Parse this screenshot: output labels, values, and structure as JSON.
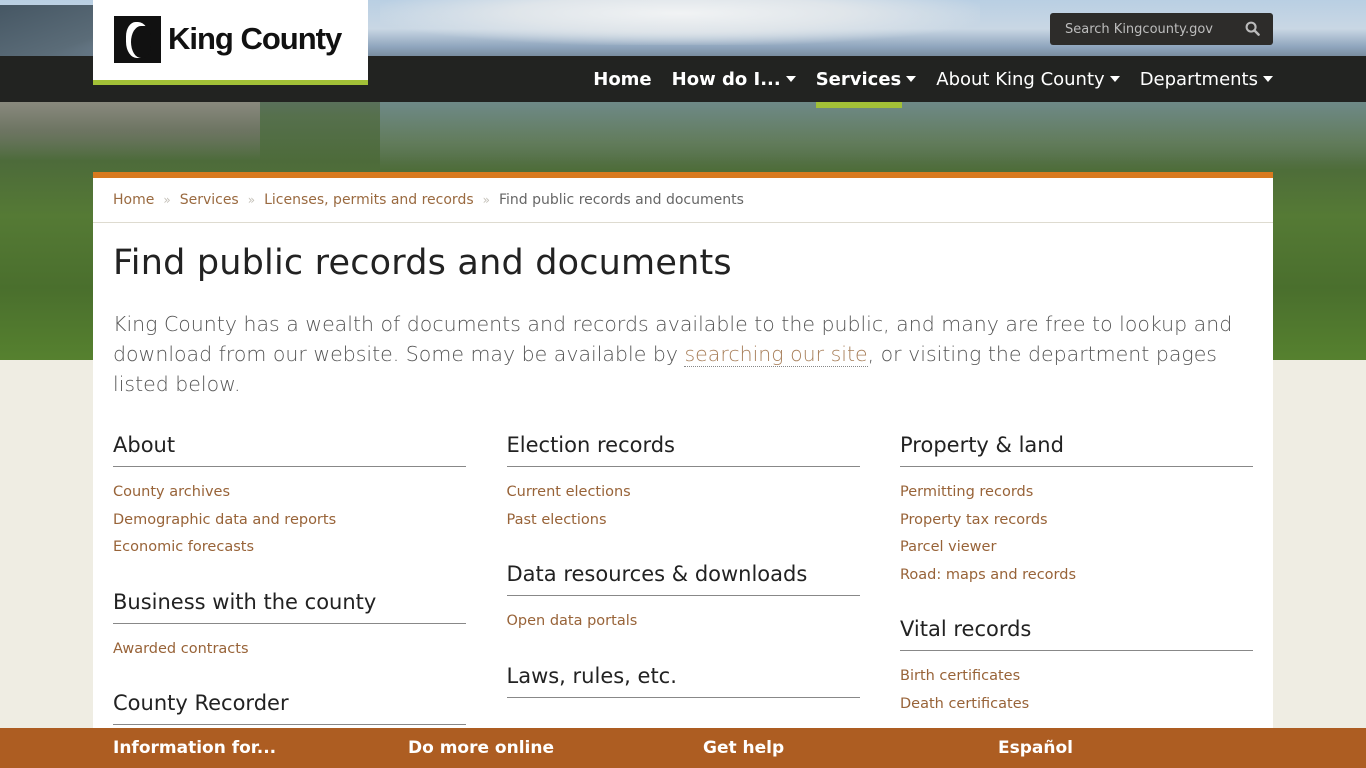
{
  "header": {
    "logo_text": "King County",
    "search_placeholder": "Search Kingcounty.gov",
    "nav": [
      {
        "label": "Home",
        "has_dropdown": false,
        "active": false
      },
      {
        "label": "How do I...",
        "has_dropdown": true,
        "active": false
      },
      {
        "label": "Services",
        "has_dropdown": true,
        "active": true
      },
      {
        "label": "About King County",
        "has_dropdown": true,
        "active": false
      },
      {
        "label": "Departments",
        "has_dropdown": true,
        "active": false
      }
    ]
  },
  "breadcrumb": [
    {
      "label": "Home"
    },
    {
      "label": "Services"
    },
    {
      "label": "Licenses, permits and records"
    },
    {
      "label": "Find public records and documents"
    }
  ],
  "page": {
    "title": "Find public records and documents",
    "intro_before": "King County has a wealth of documents and records available to the public, and many are free to lookup and download from our website. Some may be available by ",
    "intro_link": "searching our site",
    "intro_after": ", or visiting the department pages listed below."
  },
  "columns": [
    [
      {
        "heading": "About",
        "links": [
          "County archives",
          "Demographic data and reports",
          "Economic forecasts"
        ]
      },
      {
        "heading": "Business with the county",
        "links": [
          "Awarded contracts"
        ]
      },
      {
        "heading": "County Recorder",
        "links": []
      }
    ],
    [
      {
        "heading": "Election records",
        "links": [
          "Current elections",
          "Past elections"
        ]
      },
      {
        "heading": "Data resources & downloads",
        "links": [
          "Open data portals"
        ]
      },
      {
        "heading": "Laws, rules, etc.",
        "links": []
      }
    ],
    [
      {
        "heading": "Property & land",
        "links": [
          "Permitting records",
          "Property tax records",
          "Parcel viewer",
          "Road: maps and records"
        ]
      },
      {
        "heading": "Vital records",
        "links": [
          "Birth certificates",
          "Death certificates"
        ]
      }
    ]
  ],
  "footer": {
    "items": [
      "Information for...",
      "Do more online",
      "Get help",
      "Español"
    ]
  },
  "colors": {
    "accent_green": "#a2c037",
    "accent_orange": "#d87a1f",
    "footer_brown": "#ad5d22",
    "link_brown": "#986338",
    "nav_bg": "#222321"
  }
}
